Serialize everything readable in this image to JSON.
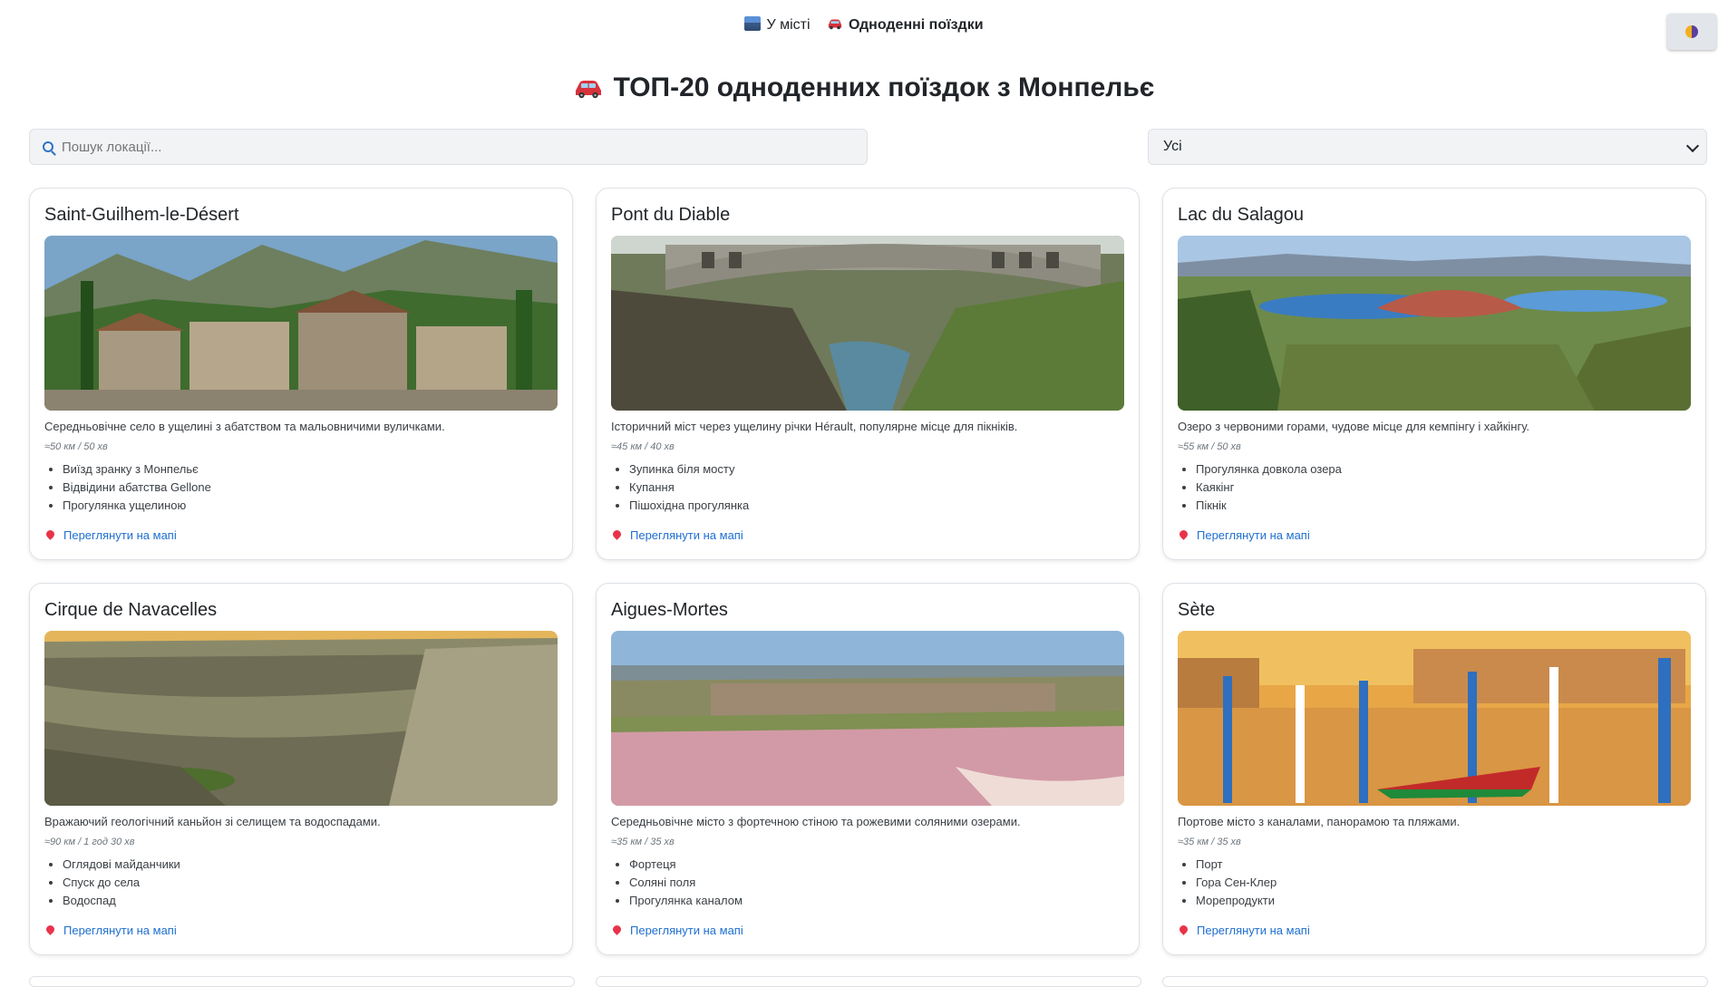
{
  "nav": {
    "items": [
      {
        "label": "У місті",
        "icon": "cityscape-icon",
        "active": false
      },
      {
        "label": "Одноденні поїздки",
        "icon": "car-icon",
        "active": true
      }
    ],
    "theme_toggle_icon": "half-moon-icon"
  },
  "page": {
    "title": "ТОП-20 одноденних поїздок з Монпельє",
    "title_icon": "car-icon"
  },
  "search": {
    "placeholder": "Пошук локації...",
    "icon": "magnifier-icon"
  },
  "filter": {
    "selected": "Усі"
  },
  "map_link_label": "Переглянути на мапі",
  "cards": [
    {
      "title": "Saint-Guilhem-le-Désert",
      "description": "Середньовічне село в ущелині з абатством та мальовничими вуличками.",
      "distance": "≈50 км / 50 хв",
      "items": [
        "Виїзд зранку з Монпельє",
        "Відвідини абатства Gellone",
        "Прогулянка ущелиною"
      ]
    },
    {
      "title": "Pont du Diable",
      "description": "Історичний міст через ущелину річки Hérault, популярне місце для пікніків.",
      "distance": "≈45 км / 40 хв",
      "items": [
        "Зупинка біля мосту",
        "Купання",
        "Пішохідна прогулянка"
      ]
    },
    {
      "title": "Lac du Salagou",
      "description": "Озеро з червоними горами, чудове місце для кемпінгу і хайкінгу.",
      "distance": "≈55 км / 50 хв",
      "items": [
        "Прогулянка довкола озера",
        "Каякінг",
        "Пікнік"
      ]
    },
    {
      "title": "Cirque de Navacelles",
      "description": "Вражаючий геологічний каньйон зі селищем та водоспадами.",
      "distance": "≈90 км / 1 год 30 хв",
      "items": [
        "Оглядові майданчики",
        "Спуск до села",
        "Водоспад"
      ]
    },
    {
      "title": "Aigues-Mortes",
      "description": "Середньовічне місто з фортечною стіною та рожевими соляними озерами.",
      "distance": "≈35 км / 35 хв",
      "items": [
        "Фортеця",
        "Соляні поля",
        "Прогулянка каналом"
      ]
    },
    {
      "title": "Sète",
      "description": "Портове місто з каналами, панорамою та пляжами.",
      "distance": "≈35 км / 35 хв",
      "items": [
        "Порт",
        "Гора Сен-Клер",
        "Морепродукти"
      ]
    }
  ]
}
